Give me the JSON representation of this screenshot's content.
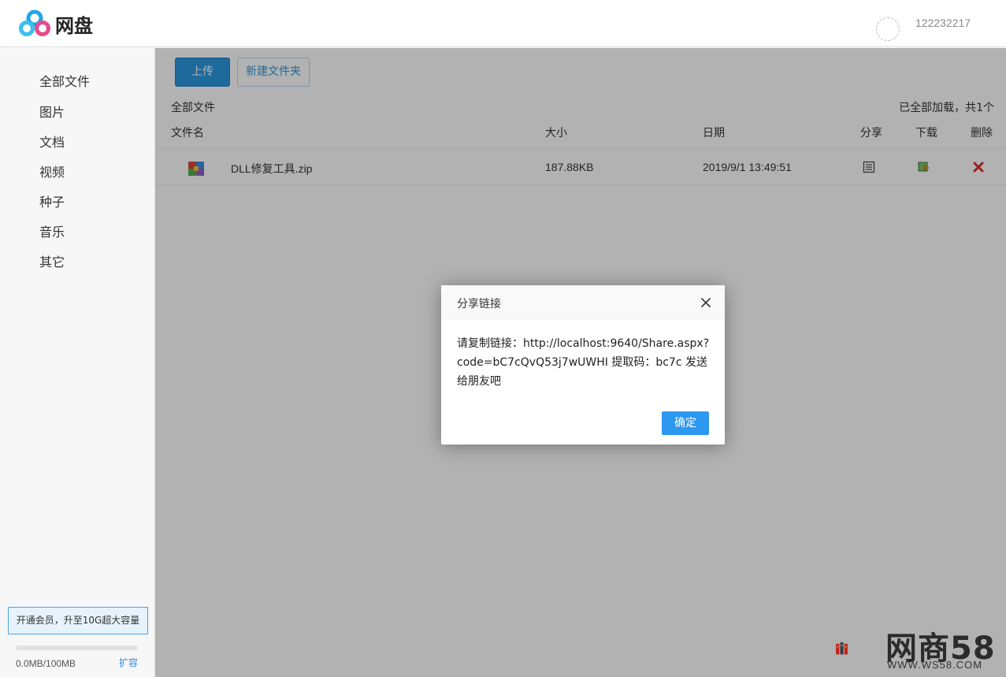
{
  "header": {
    "brand": "网盘",
    "user_id": "122232217"
  },
  "sidebar": {
    "items": [
      {
        "label": "全部文件"
      },
      {
        "label": "图片"
      },
      {
        "label": "文档"
      },
      {
        "label": "视频"
      },
      {
        "label": "种子"
      },
      {
        "label": "音乐"
      },
      {
        "label": "其它"
      }
    ],
    "vip_label": "开通会员，升至10G超大容量",
    "quota_text": "0.0MB/100MB",
    "quota_fraction": 0.0,
    "expand_label": "扩容"
  },
  "toolbar": {
    "upload_label": "上传",
    "new_folder_label": "新建文件夹"
  },
  "main": {
    "breadcrumb": "全部文件",
    "load_status": "已全部加载，共1个",
    "columns": {
      "name": "文件名",
      "size": "大小",
      "date": "日期",
      "share": "分享",
      "download": "下载",
      "delete": "删除"
    },
    "files": [
      {
        "name": "DLL修复工具.zip",
        "size": "187.88KB",
        "date": "2019/9/1 13:49:51",
        "icon": "zip-icon"
      }
    ]
  },
  "dialog": {
    "title": "分享链接",
    "message": "请复制链接：http://localhost:9640/Share.aspx?code=bC7cQvQ53j7wUWHI 提取码：bc7c 发送给朋友吧",
    "ok_label": "确定"
  },
  "watermark": {
    "text": "网商58",
    "url": "WWW.WS58.COM"
  },
  "colors": {
    "accent": "#2c98e0",
    "sidebar_bg": "#f7f7f7",
    "delete": "#d9302a"
  }
}
